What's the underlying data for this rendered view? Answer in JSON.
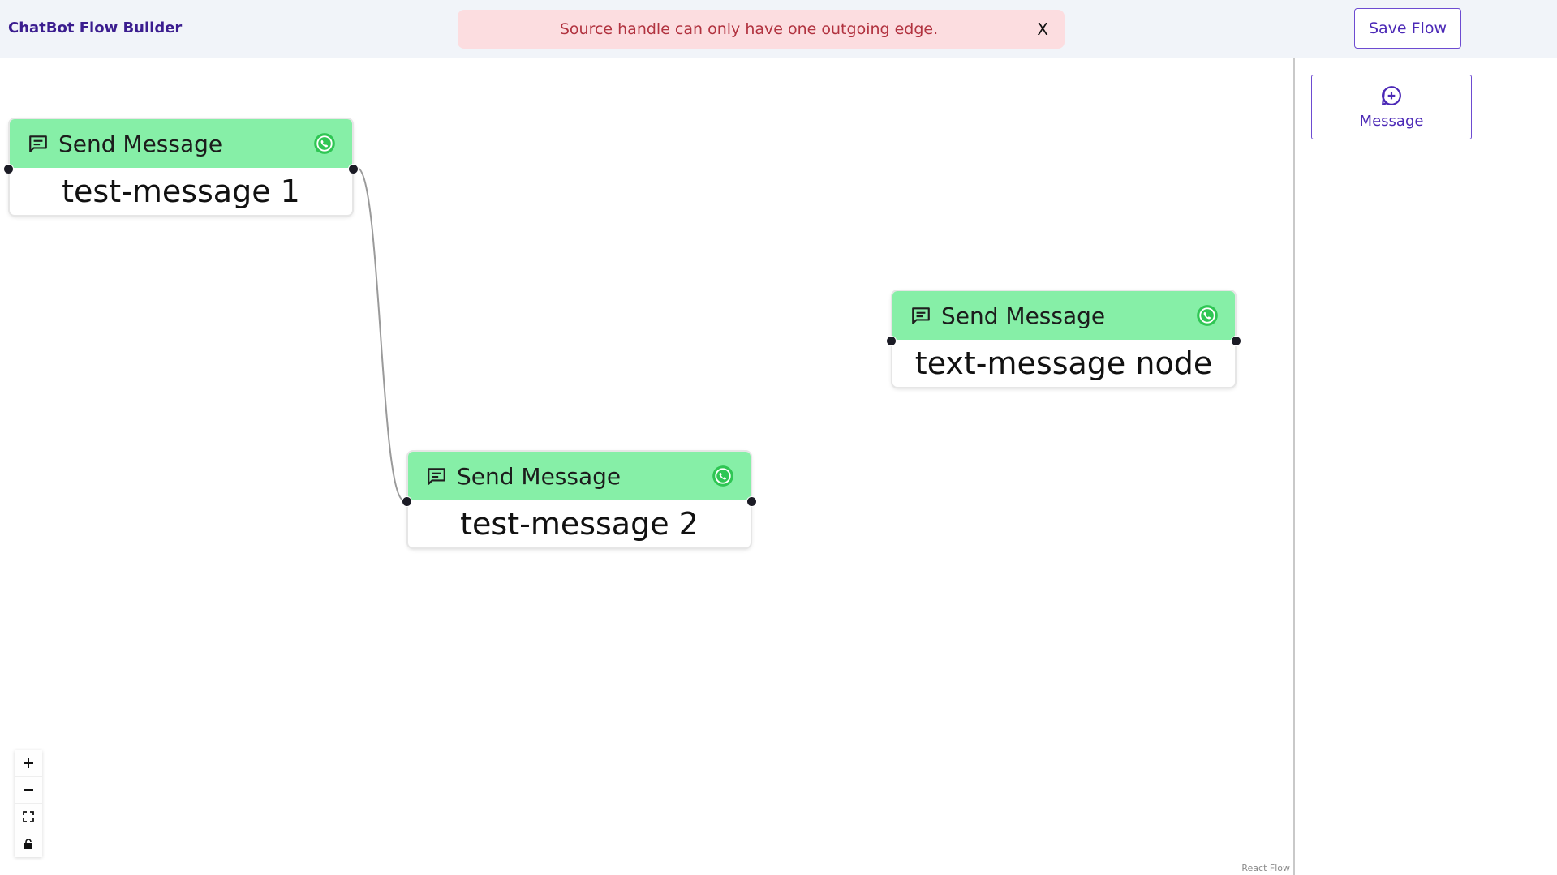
{
  "app": {
    "title": "ChatBot Flow Builder"
  },
  "error": {
    "message": "Source handle can only have one outgoing edge.",
    "close_label": "X"
  },
  "toolbar": {
    "save_label": "Save Flow"
  },
  "sidebar": {
    "message_button_label": "Message",
    "icon": "plus-circle-icon"
  },
  "nodes": [
    {
      "type_label": "Send Message",
      "text": "test-message 1",
      "icons": [
        "message-square-icon",
        "whatsapp-icon"
      ]
    },
    {
      "type_label": "Send Message",
      "text": "test-message 2",
      "icons": [
        "message-square-icon",
        "whatsapp-icon"
      ]
    },
    {
      "type_label": "Send Message",
      "text": "text-message node",
      "icons": [
        "message-square-icon",
        "whatsapp-icon"
      ]
    }
  ],
  "edges": [
    {
      "from": "test-message 1",
      "to": "test-message 2"
    }
  ],
  "controls": [
    {
      "name": "zoom-in",
      "glyph": "+"
    },
    {
      "name": "zoom-out",
      "glyph": "−"
    },
    {
      "name": "fit-view",
      "glyph": "⛶"
    },
    {
      "name": "lock",
      "glyph": "🔒"
    }
  ],
  "attribution": "React Flow",
  "colors": {
    "header_bg": "#f1f4f9",
    "accent": "#4b28b6",
    "node_header": "#86efa7",
    "error_bg": "#fcdde0",
    "error_text": "#b1323f"
  }
}
